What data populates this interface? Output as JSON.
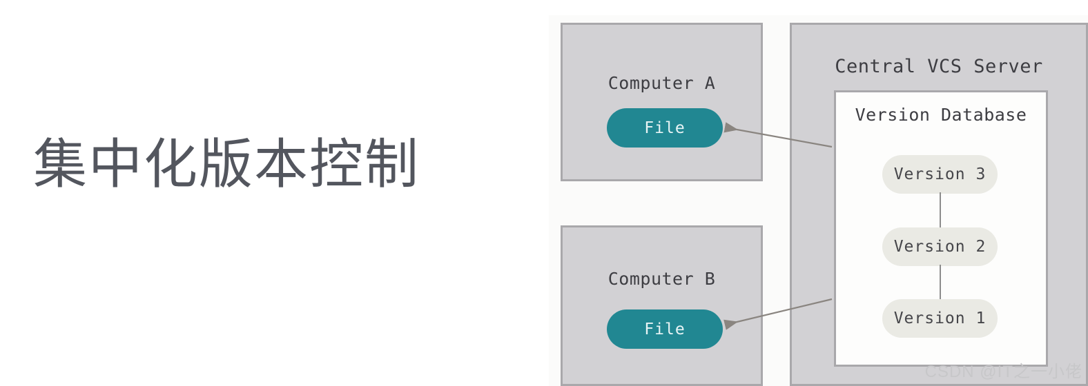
{
  "headline": {
    "text": "集中化版本控制"
  },
  "diagram": {
    "computer_a": {
      "title": "Computer A",
      "file_label": "File"
    },
    "computer_b": {
      "title": "Computer B",
      "file_label": "File"
    },
    "server": {
      "title": "Central VCS Server",
      "database": {
        "title": "Version Database",
        "versions": [
          {
            "label": "Version 3"
          },
          {
            "label": "Version 2"
          },
          {
            "label": "Version 1"
          }
        ]
      }
    },
    "arrows": [
      {
        "name": "arrow-db-to-computer-a",
        "from": "Version Database",
        "to": "Computer A File"
      },
      {
        "name": "arrow-db-to-computer-b",
        "from": "Version Database",
        "to": "Computer B File"
      }
    ]
  },
  "watermark": {
    "text": "CSDN @IT之一小佬"
  },
  "colors": {
    "background": "#ffffff",
    "figure_background": "#fbfbfa",
    "panel_fill": "#d2d1d4",
    "panel_border": "#a9a8ab",
    "file_pill": "#218792",
    "file_pill_text": "#e8f4f5",
    "version_pill": "#eaeae4",
    "version_pill_text": "#46464a",
    "database_fill": "#fdfdfc",
    "headline_text": "#53565e",
    "arrow": "#8a8580",
    "watermark_text": "#c7c7c9"
  }
}
